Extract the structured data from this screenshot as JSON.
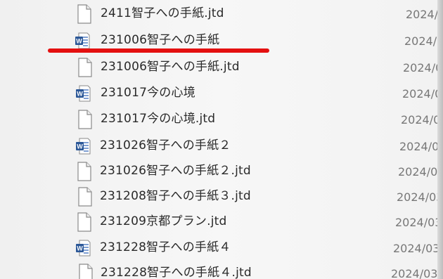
{
  "files": [
    {
      "name": "2411智子への手紙.jtd",
      "date": "2024/",
      "type": "doc"
    },
    {
      "name": "231006智子への手紙",
      "date": "2024/0",
      "type": "word"
    },
    {
      "name": "231006智子への手紙.jtd",
      "date": "2024/0",
      "type": "doc"
    },
    {
      "name": "231017今の心境",
      "date": "2024/0",
      "type": "word"
    },
    {
      "name": "231017今の心境.jtd",
      "date": "2024/0",
      "type": "doc"
    },
    {
      "name": "231026智子への手紙２",
      "date": "2024/0",
      "type": "word"
    },
    {
      "name": "231026智子への手紙２.jtd",
      "date": "2024/03",
      "type": "doc"
    },
    {
      "name": "231208智子への手紙３.jtd",
      "date": "2024/03",
      "type": "doc"
    },
    {
      "name": "231209京都プラン.jtd",
      "date": "2024/03",
      "type": "doc"
    },
    {
      "name": "231228智子への手紙４",
      "date": "2024/03",
      "type": "word"
    },
    {
      "name": "231228智子への手紙４.jtd",
      "date": "2024/03",
      "type": "doc"
    }
  ],
  "colors": {
    "highlight": "#e41010",
    "word_icon": "#2b5797"
  }
}
